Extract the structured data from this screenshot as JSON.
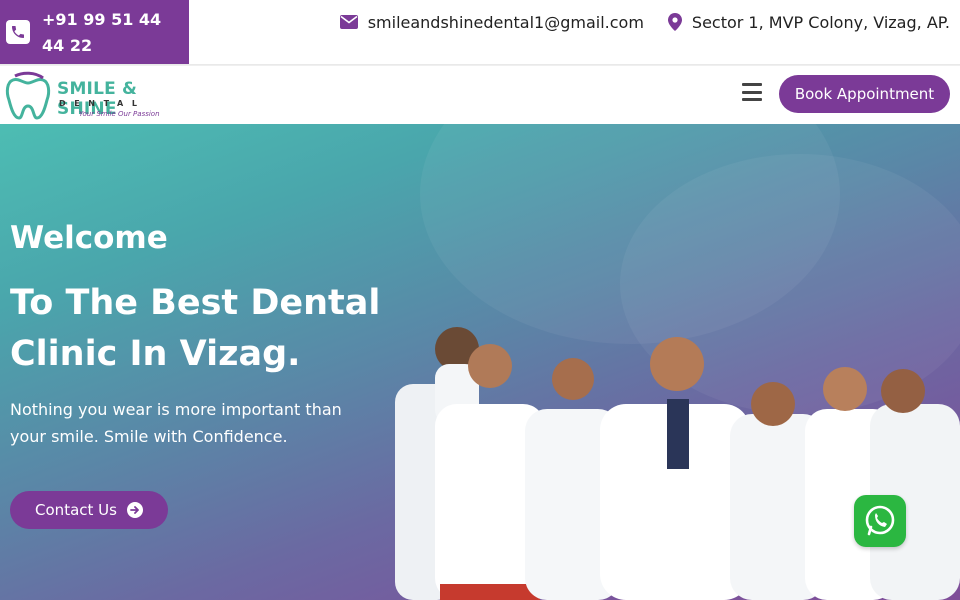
{
  "topbar": {
    "phone": "+91 99 51 44 44 22",
    "email": "smileandshinedental1@gmail.com",
    "address": "Sector 1, MVP Colony, Vizag, AP."
  },
  "logo": {
    "title": "SMILE & SHINE",
    "subtitle": "DENTAL",
    "tagline": "Your Smile Our Passion"
  },
  "nav": {
    "menu_icon": "hamburger-icon",
    "book_label": "Book Appointment"
  },
  "hero": {
    "welcome": "Welcome",
    "headline": "To The Best Dental Clinic In Vizag.",
    "tagline": "Nothing you wear is more important than your smile. Smile with Confidence.",
    "cta_label": "Contact Us"
  },
  "colors": {
    "brand_purple": "#7b3a97",
    "brand_teal": "#44b39d",
    "whatsapp_green": "#2bb741"
  },
  "icons": [
    "phone-icon",
    "envelope-icon",
    "map-pin-icon",
    "hamburger-icon",
    "arrow-circle-right-icon",
    "whatsapp-icon"
  ]
}
